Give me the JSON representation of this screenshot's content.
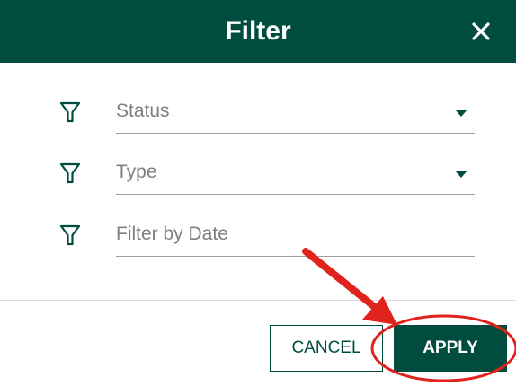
{
  "dialog": {
    "title": "Filter",
    "close_icon": "close-icon"
  },
  "filters": [
    {
      "placeholder": "Status",
      "icon": "filter-funnel-icon",
      "has_dropdown": true
    },
    {
      "placeholder": "Type",
      "icon": "filter-funnel-icon",
      "has_dropdown": true
    },
    {
      "placeholder": "Filter by Date",
      "icon": "filter-funnel-icon",
      "has_dropdown": false
    }
  ],
  "actions": {
    "cancel_label": "CANCEL",
    "apply_label": "APPLY"
  },
  "annotation": {
    "color": "#e0231c",
    "marks": [
      "arrow-icon",
      "highlight-ellipse"
    ]
  },
  "colors": {
    "primary": "#004d40",
    "text_muted": "#808080"
  }
}
